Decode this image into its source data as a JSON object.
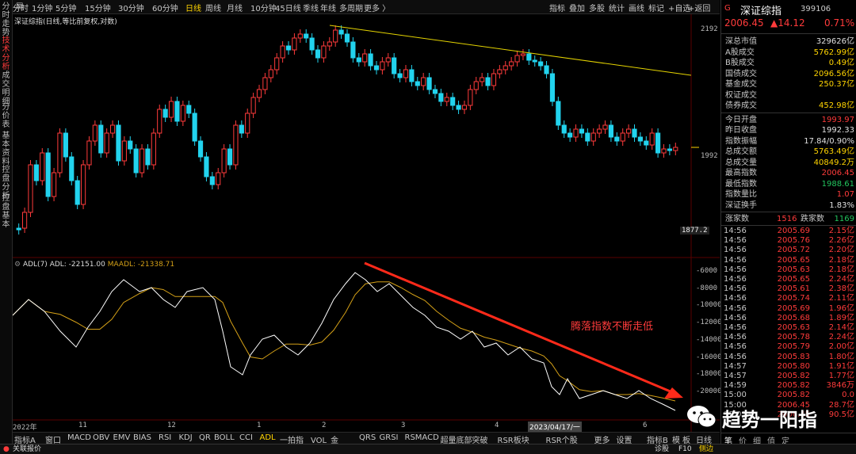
{
  "left_nav": [
    "分时走势",
    "技术分析",
    "成交明细",
    "分价表",
    "基本资料",
    "控盘分析",
    "控盘基本"
  ],
  "toolbar": {
    "periods": [
      "分时",
      "1分钟",
      "5分钟",
      "15分钟",
      "30分钟",
      "60分钟",
      "日线",
      "周线",
      "月线",
      "10分钟",
      "45日线",
      "季线",
      "年线",
      "多周期",
      "更多 〉"
    ],
    "active_period": "日线",
    "right_items": [
      "指标",
      "叠加",
      "多股",
      "统计",
      "画线",
      "标记",
      "+自选",
      "+返回"
    ]
  },
  "chart": {
    "title": "深证综指(日线,等比前复权,对数)",
    "price_ticks": [
      "2192",
      "1992",
      "1877.2"
    ],
    "adl_title": "ADL(7)",
    "adl_value": "ADL: -22151.00",
    "maadl_value": "MAADL: -21338.71",
    "adl_ticks": [
      "-6000",
      "-8000",
      "-10000",
      "-12000",
      "-14000",
      "-16000",
      "-18000",
      "-20000"
    ],
    "annotation": "腾落指数不断走低",
    "x_labels": [
      "2022年",
      "11",
      "12",
      "1",
      "2",
      "3",
      "4",
      "6"
    ],
    "cursor_date": "2023/04/17/一",
    "indicators_right": [
      "指标B",
      "模",
      "板",
      "日线"
    ]
  },
  "indicator_tabs": [
    "指标A",
    "窗口",
    "MACD",
    "OBV",
    "EMV",
    "BIAS",
    "RSI",
    "KDJ",
    "QR",
    "BOLL",
    "CCI",
    "ADL",
    "一拍指",
    "VOL_金",
    "QRS",
    "GRSI",
    "RSMACD",
    "超量底部突破",
    "RSR板块",
    "RSR个股",
    "更多",
    "设置"
  ],
  "active_indicator": "ADL",
  "quote": {
    "marker": "G",
    "name": "深证综指",
    "code": "399106",
    "price": "2006.45",
    "change": "▲14.12",
    "pct": "0.71%",
    "stats": [
      {
        "k": "深总市值",
        "v": "329626亿",
        "c": "white"
      },
      {
        "k": "A股成交",
        "v": "5762.99亿",
        "c": "yellow"
      },
      {
        "k": "B股成交",
        "v": "0.49亿",
        "c": "yellow"
      },
      {
        "k": "国债成交",
        "v": "2096.56亿",
        "c": "yellow"
      },
      {
        "k": "基金成交",
        "v": "250.37亿",
        "c": "yellow"
      },
      {
        "k": "权证成交",
        "v": "",
        "c": "yellow"
      },
      {
        "k": "债券成交",
        "v": "452.98亿",
        "c": "yellow"
      }
    ],
    "stats2": [
      {
        "k": "今日开盘",
        "v": "1993.97",
        "c": "red"
      },
      {
        "k": "昨日收盘",
        "v": "1992.33",
        "c": "white"
      },
      {
        "k": "指数振幅",
        "v": "17.84/0.90%",
        "c": "white"
      },
      {
        "k": "总成交额",
        "v": "5763.49亿",
        "c": "yellow"
      },
      {
        "k": "总成交量",
        "v": "40849.2万",
        "c": "yellow"
      },
      {
        "k": "最高指数",
        "v": "2006.45",
        "c": "red"
      },
      {
        "k": "最低指数",
        "v": "1988.61",
        "c": "green"
      },
      {
        "k": "指数量比",
        "v": "1.07",
        "c": "red"
      },
      {
        "k": "深证换手",
        "v": "1.83%",
        "c": "white"
      }
    ],
    "up_label": "涨家数",
    "up": "1516",
    "down_label": "跌家数",
    "down": "1169"
  },
  "ticks": [
    {
      "t": "14:56",
      "p": "2005.69",
      "v": "2.15亿"
    },
    {
      "t": "14:56",
      "p": "2005.76",
      "v": "2.26亿"
    },
    {
      "t": "14:56",
      "p": "2005.72",
      "v": "2.20亿"
    },
    {
      "t": "14:56",
      "p": "2005.65",
      "v": "2.18亿"
    },
    {
      "t": "14:56",
      "p": "2005.63",
      "v": "2.18亿"
    },
    {
      "t": "14:56",
      "p": "2005.65",
      "v": "2.24亿"
    },
    {
      "t": "14:56",
      "p": "2005.61",
      "v": "2.38亿"
    },
    {
      "t": "14:56",
      "p": "2005.74",
      "v": "2.11亿"
    },
    {
      "t": "14:56",
      "p": "2005.69",
      "v": "1.96亿"
    },
    {
      "t": "14:56",
      "p": "2005.68",
      "v": "1.89亿"
    },
    {
      "t": "14:56",
      "p": "2005.63",
      "v": "2.14亿"
    },
    {
      "t": "14:56",
      "p": "2005.78",
      "v": "2.24亿"
    },
    {
      "t": "14:56",
      "p": "2005.79",
      "v": "2.00亿"
    },
    {
      "t": "14:56",
      "p": "2005.83",
      "v": "1.80亿"
    },
    {
      "t": "14:57",
      "p": "2005.80",
      "v": "1.91亿"
    },
    {
      "t": "14:57",
      "p": "2005.82",
      "v": "1.77亿"
    },
    {
      "t": "14:59",
      "p": "2005.82",
      "v": "3846万"
    },
    {
      "t": "15:00",
      "p": "2005.82",
      "v": "0.0"
    },
    {
      "t": "15:00",
      "p": "2006.45",
      "v": "28.7亿"
    },
    {
      "t": "15:01",
      "p": "2006.45",
      "v": "90.5亿"
    }
  ],
  "statusbar": {
    "left": "关联报价",
    "mid": "诊股",
    "key": "F10",
    "right": "侧边"
  },
  "watermark": "趋势一阳指",
  "colors": {
    "up": "#ff3b3b",
    "down": "#22d3ee",
    "trend": "#e5d400",
    "ma": "#d4a017",
    "adl": "#ffffff",
    "arrow": "#ff2a1a"
  }
}
